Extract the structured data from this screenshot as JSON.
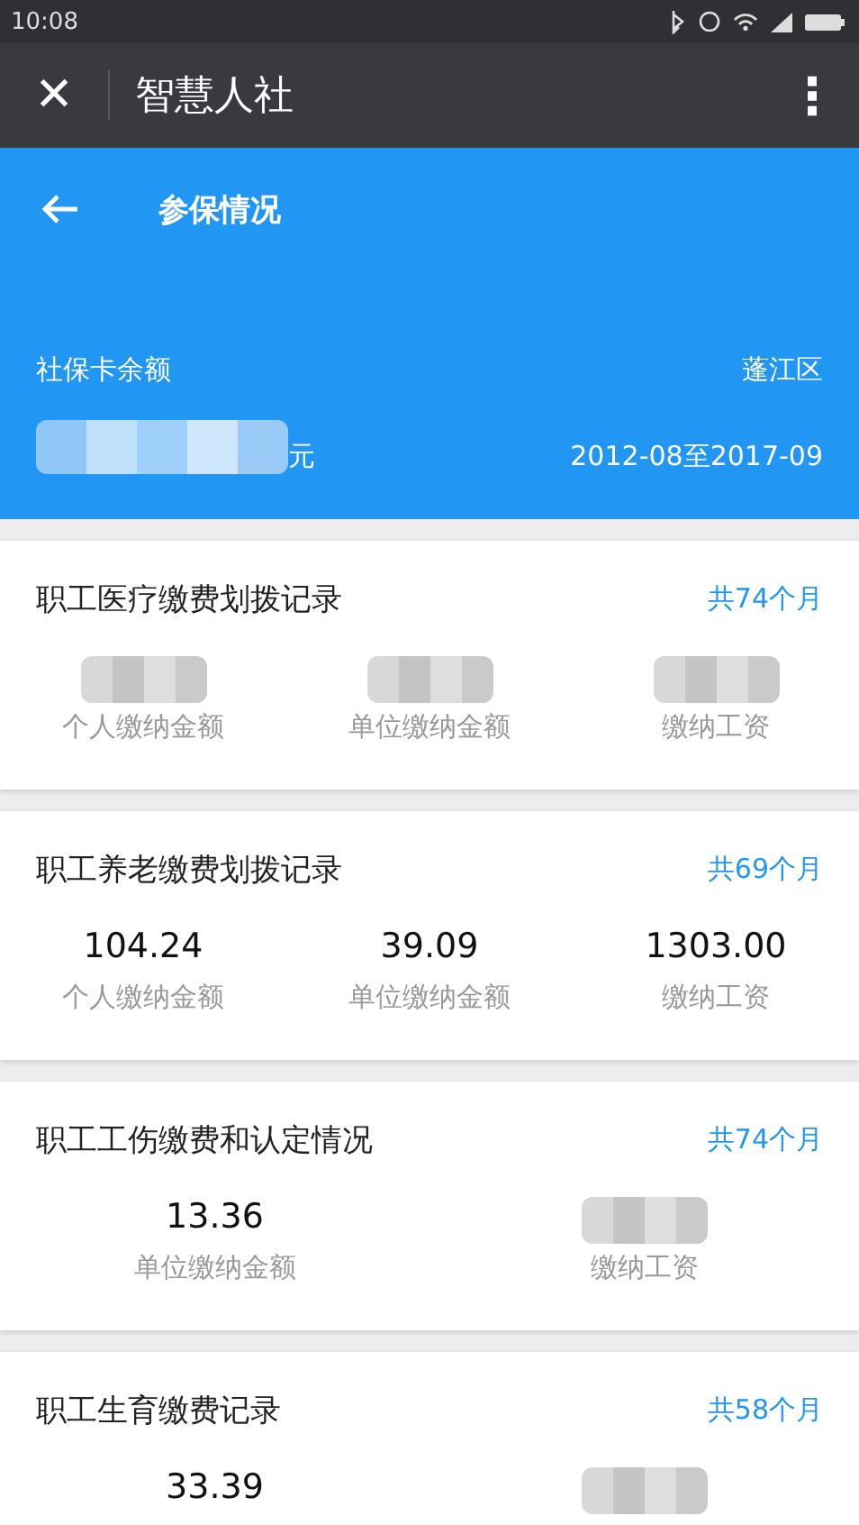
{
  "status_bar": {
    "time": "10:08"
  },
  "app_bar": {
    "close": "✕",
    "title": "智慧人社",
    "menu": "⋮"
  },
  "header": {
    "title": "参保情况",
    "balance_label": "社保卡余额",
    "district": "蓬江区",
    "balance": {
      "masked": true,
      "unit": "元"
    },
    "period": "2012-08至2017-09"
  },
  "cards": [
    {
      "title": "职工医疗缴费划拨记录",
      "count": "共74个月",
      "items": [
        {
          "masked": true,
          "label": "个人缴纳金额"
        },
        {
          "masked": true,
          "label": "单位缴纳金额"
        },
        {
          "masked": true,
          "label": "缴纳工资"
        }
      ]
    },
    {
      "title": "职工养老缴费划拨记录",
      "count": "共69个月",
      "items": [
        {
          "masked": false,
          "value": "104.24",
          "label": "个人缴纳金额"
        },
        {
          "masked": false,
          "value": "39.09",
          "label": "单位缴纳金额"
        },
        {
          "masked": false,
          "value": "1303.00",
          "label": "缴纳工资"
        }
      ]
    },
    {
      "title": "职工工伤缴费和认定情况",
      "count": "共74个月",
      "items": [
        {
          "masked": false,
          "value": "13.36",
          "label": "单位缴纳金额"
        },
        {
          "masked": true,
          "label": "缴纳工资"
        }
      ]
    },
    {
      "title": "职工生育缴费记录",
      "count": "共58个月",
      "items": [
        {
          "masked": false,
          "value": "33.39"
        },
        {
          "masked": true
        }
      ]
    }
  ]
}
